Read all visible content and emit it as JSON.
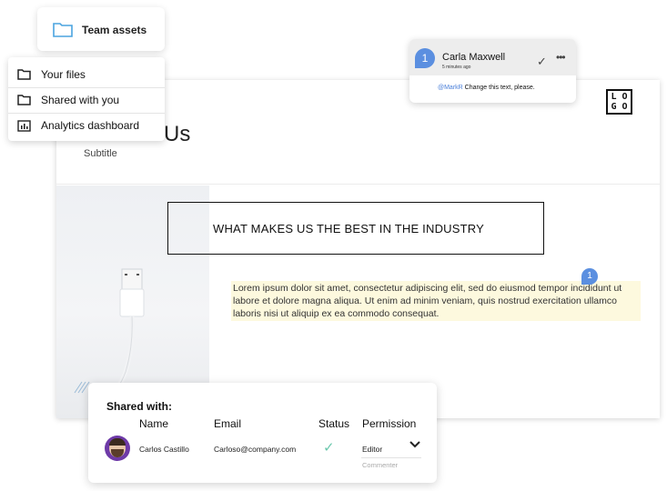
{
  "team_card": {
    "label": "Team assets",
    "icon": "folder-icon"
  },
  "menu": {
    "items": [
      {
        "label": "Your files",
        "icon": "folder-icon"
      },
      {
        "label": "Shared with you",
        "icon": "folder-icon"
      },
      {
        "label": "Analytics dashboard",
        "icon": "bar-chart-icon"
      }
    ]
  },
  "slide": {
    "title_partial": "Us",
    "subtitle": "Subtitle",
    "logo_line1": "L O",
    "logo_line2": "G O",
    "headline": "WHAT MAKES US THE BEST IN THE INDUSTRY",
    "body": "Lorem ipsum dolor sit amet, consectetur adipiscing elit, sed do eiusmod tempor incididunt ut labore et dolore magna aliqua. Ut enim ad minim veniam, quis nostrud exercitation ullamco laboris nisi ut aliquip ex ea commodo consequat.",
    "comment_marker": "1"
  },
  "comment": {
    "marker": "1",
    "author": "Carla Maxwell",
    "time": "5 minutes ago",
    "mention": "@MarkR",
    "text": " Change this text, please."
  },
  "share": {
    "heading": "Shared with:",
    "columns": {
      "name": "Name",
      "email": "Email",
      "status": "Status",
      "permission": "Permission"
    },
    "row": {
      "name": "Carlos Castillo",
      "email": "Carloso@company.com",
      "permission": "Editor",
      "permission_option": "Commenter"
    }
  },
  "colors": {
    "accent": "#5b8fe0",
    "highlight": "#fdf9de",
    "check": "#6cc8ae",
    "avatar_bg": "#6e3aa8"
  }
}
